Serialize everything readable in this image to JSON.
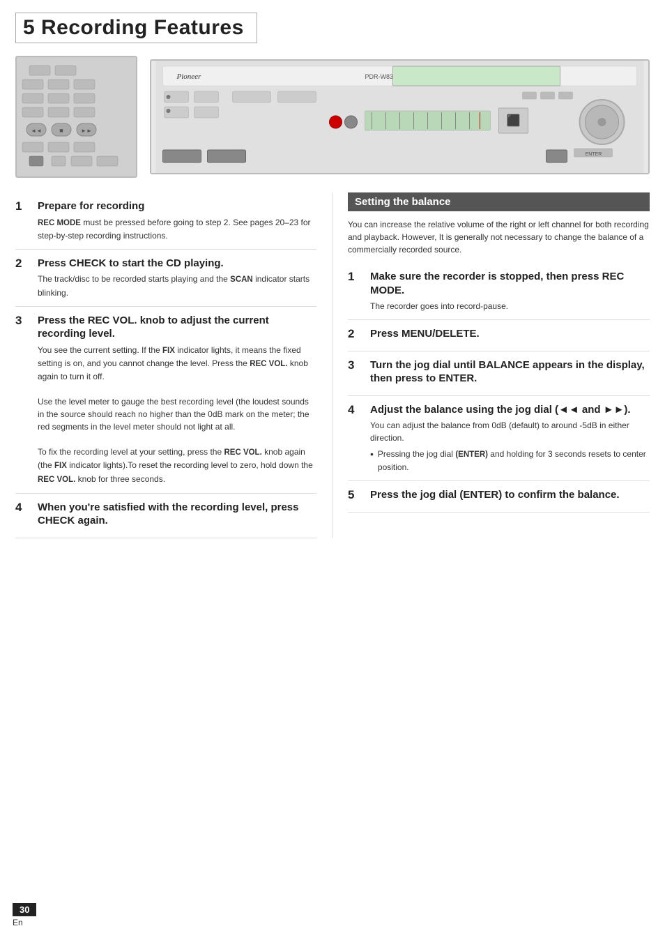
{
  "page": {
    "title": "5 Recording Features",
    "page_number": "30",
    "lang": "En"
  },
  "left_column": {
    "steps": [
      {
        "number": "1",
        "title": "Prepare for recording",
        "body_html": "<b>REC MODE</b> must be pressed before going to step 2. See pages 20–23 for step-by-step recording instructions."
      },
      {
        "number": "2",
        "title": "Press CHECK to start the CD playing.",
        "body_html": "The track/disc to be recorded starts playing and the <b>SCAN</b> indicator starts blinking."
      },
      {
        "number": "3",
        "title": "Press the REC VOL. knob to adjust the current recording level.",
        "body_html": "You see the current setting. If the <b>FIX</b> indicator lights, it means the fixed setting is on, and you cannot change the level. Press the <b>REC VOL.</b> knob again to turn it off.<br><br>Use the level meter to gauge the best recording level (the loudest sounds in the source should reach no higher than the 0dB mark on the meter; the red segments in the level meter should not light at all.<br><br>To fix the recording level at your setting, press the <b>REC VOL.</b> knob again (the <b>FIX</b> indicator lights).To reset the recording level to zero, hold down the <b>REC VOL.</b> knob for three seconds."
      },
      {
        "number": "4",
        "title": "When you're satisfied with the recording level, press CHECK again.",
        "body_html": ""
      }
    ]
  },
  "right_column": {
    "section_header": "Setting the balance",
    "intro": "You can increase the relative volume of the right or left channel for both recording and playback. However, It is generally not necessary to change the balance of a commercially recorded source.",
    "steps": [
      {
        "number": "1",
        "title": "Make sure the recorder is stopped, then press REC MODE.",
        "body_html": "The recorder goes into record-pause."
      },
      {
        "number": "2",
        "title": "Press MENU/DELETE.",
        "body_html": ""
      },
      {
        "number": "3",
        "title": "Turn the jog dial until BALANCE appears in the display, then press to ENTER.",
        "body_html": ""
      },
      {
        "number": "4",
        "title": "Adjust the balance using the jog dial (◄◄ and ►►).",
        "body_html": "You can adjust the balance from 0dB (default) to around -5dB in either direction.",
        "bullet": "Pressing the jog dial <span class=\"bold-normal\"><b>(ENTER)</b></span> and holding for 3 seconds resets to center position."
      },
      {
        "number": "5",
        "title": "Press the jog dial (ENTER) to confirm the balance.",
        "body_html": ""
      }
    ]
  }
}
